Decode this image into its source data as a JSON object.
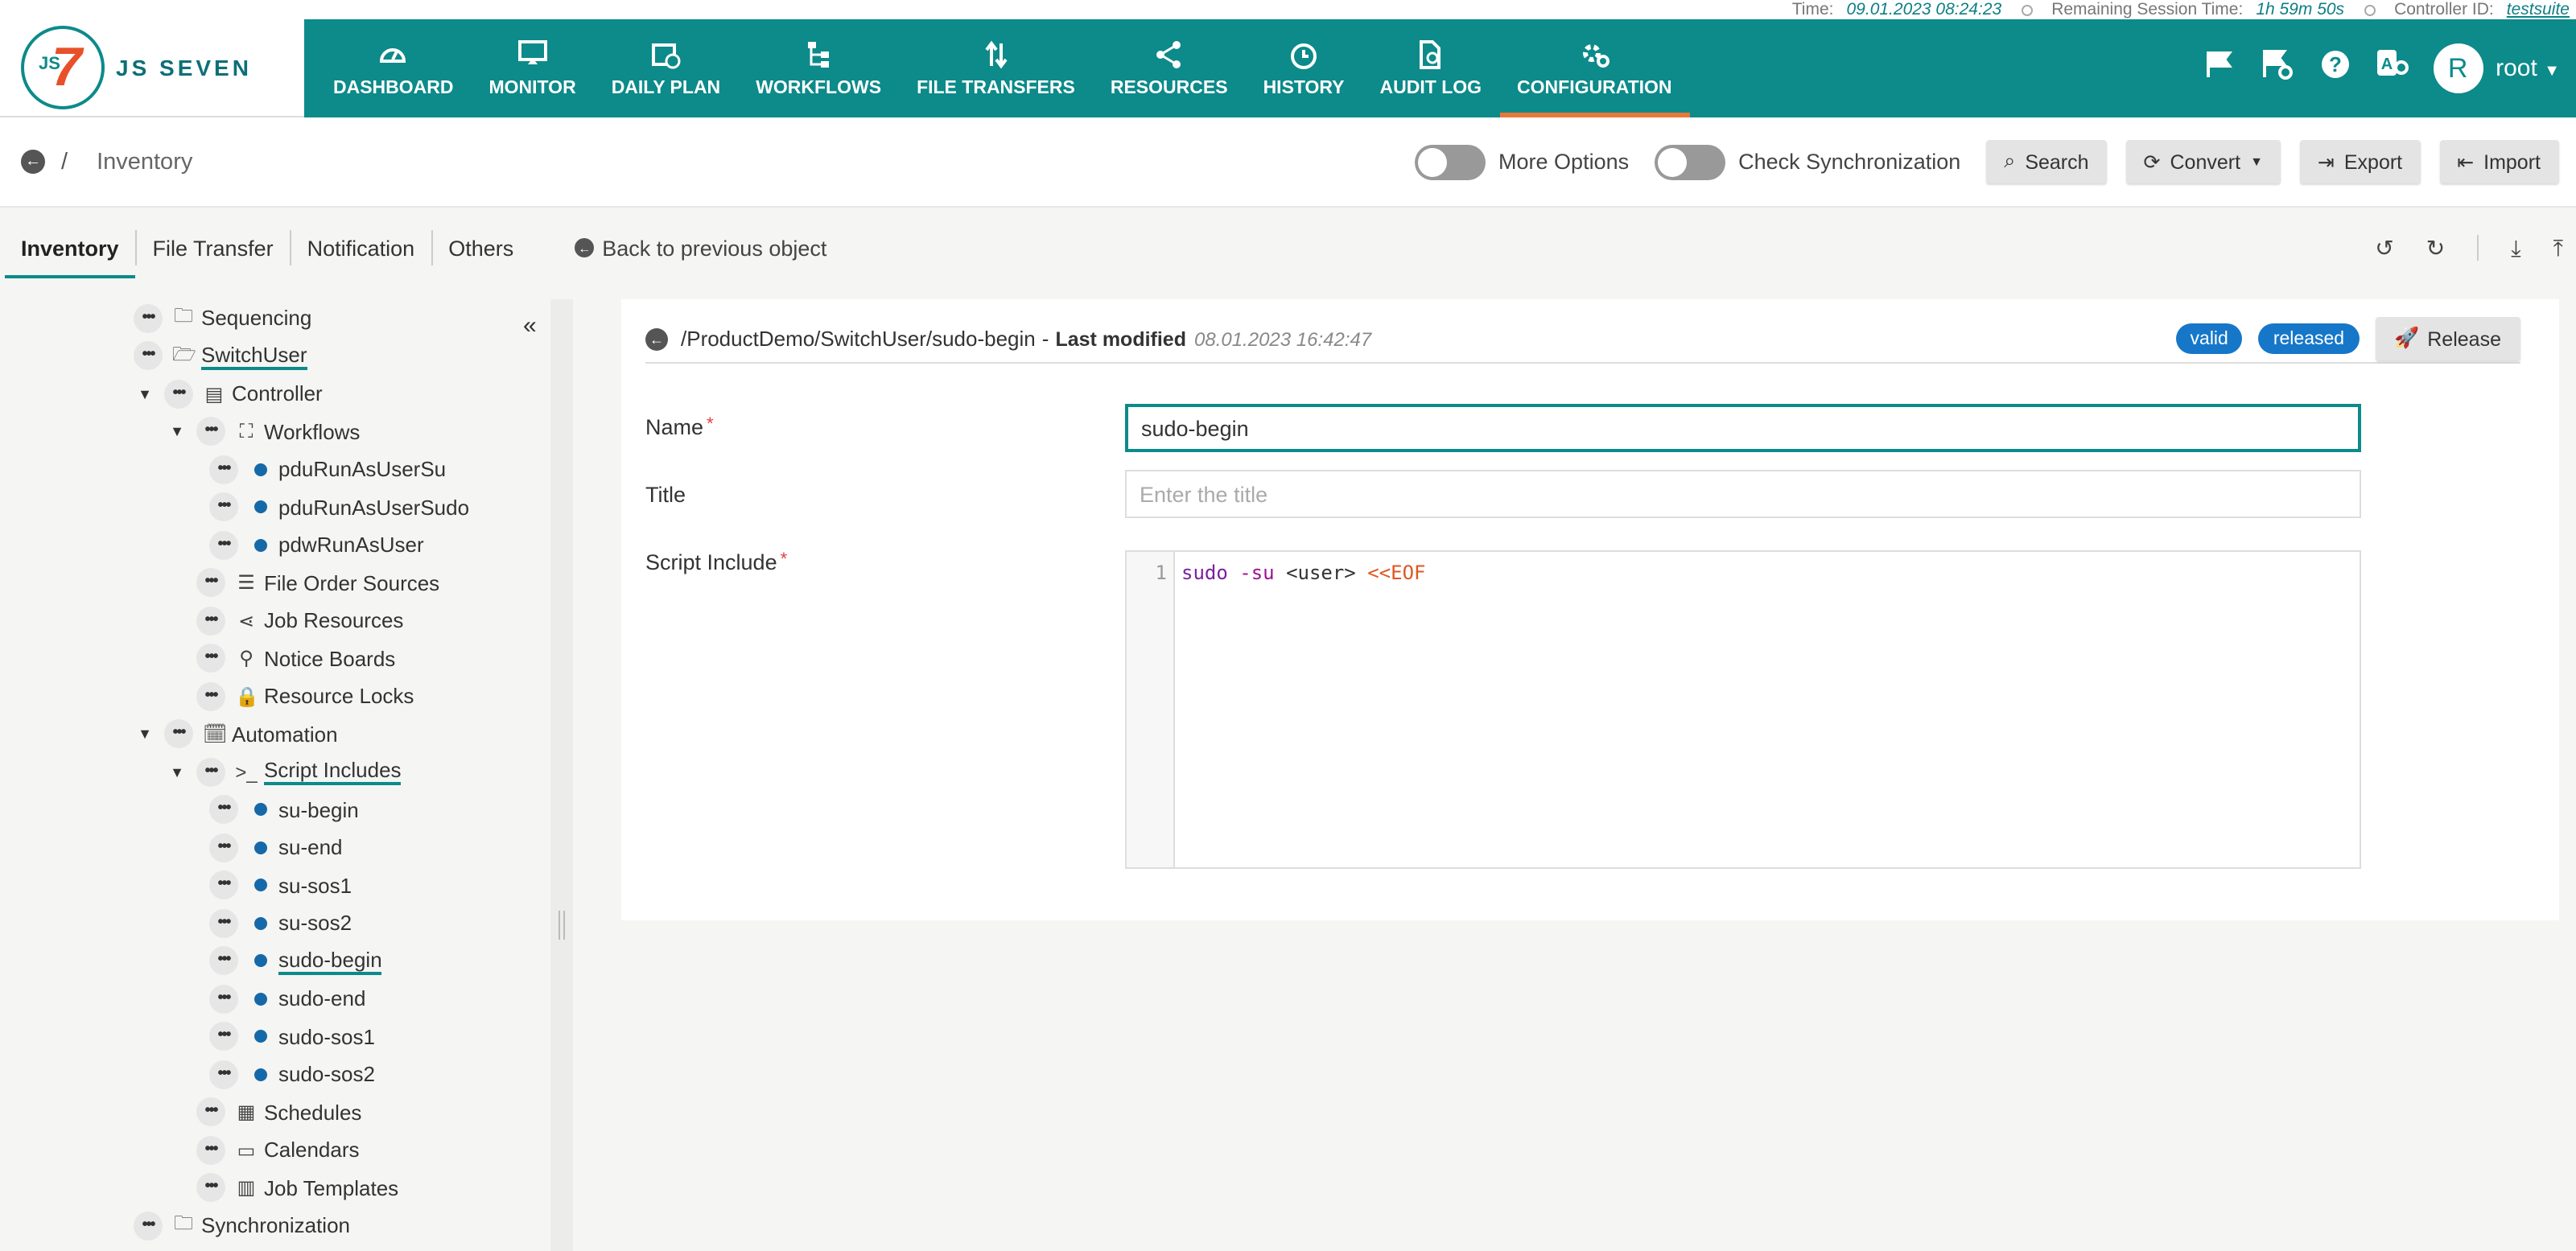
{
  "status": {
    "time_label": "Time:",
    "time_value": "09.01.2023 08:24:23",
    "session_label": "Remaining Session Time:",
    "session_value": "1h 59m 50s",
    "controller_label": "Controller ID:",
    "controller_value": "testsuite"
  },
  "brand": {
    "logo_js": "JS",
    "logo_seven": "7",
    "name": "JS SEVEN"
  },
  "nav": [
    {
      "label": "DASHBOARD",
      "icon": "dashboard-icon"
    },
    {
      "label": "MONITOR",
      "icon": "monitor-icon"
    },
    {
      "label": "DAILY PLAN",
      "icon": "calendar-clock-icon"
    },
    {
      "label": "WORKFLOWS",
      "icon": "workflow-icon"
    },
    {
      "label": "FILE TRANSFERS",
      "icon": "transfer-icon"
    },
    {
      "label": "RESOURCES",
      "icon": "share-icon"
    },
    {
      "label": "HISTORY",
      "icon": "clock-icon"
    },
    {
      "label": "AUDIT LOG",
      "icon": "audit-icon"
    },
    {
      "label": "CONFIGURATION",
      "icon": "gear-icon"
    }
  ],
  "user": {
    "initial": "R",
    "name": "root"
  },
  "subheader": {
    "breadcrumb_sep": "/",
    "page_title": "Inventory",
    "more_options": "More Options",
    "check_sync": "Check Synchronization",
    "search": "Search",
    "convert": "Convert",
    "export": "Export",
    "import": "Import"
  },
  "tabs": [
    "Inventory",
    "File Transfer",
    "Notification",
    "Others"
  ],
  "back_to_previous": "Back to previous object",
  "tree": [
    {
      "label": "Sequencing",
      "indent": 0,
      "kind": "folder"
    },
    {
      "label": "SwitchUser",
      "indent": 0,
      "kind": "folder-open"
    },
    {
      "label": "Controller",
      "indent": 1,
      "kind": "controller"
    },
    {
      "label": "Workflows",
      "indent": 2,
      "kind": "workflows"
    },
    {
      "label": "pduRunAsUserSu",
      "indent": 3,
      "kind": "item"
    },
    {
      "label": "pduRunAsUserSudo",
      "indent": 3,
      "kind": "item"
    },
    {
      "label": "pdwRunAsUser",
      "indent": 3,
      "kind": "item"
    },
    {
      "label": "File Order Sources",
      "indent": 2,
      "kind": "list"
    },
    {
      "label": "Job Resources",
      "indent": 2,
      "kind": "share"
    },
    {
      "label": "Notice Boards",
      "indent": 2,
      "kind": "pin"
    },
    {
      "label": "Resource Locks",
      "indent": 2,
      "kind": "lock"
    },
    {
      "label": "Automation",
      "indent": 1,
      "kind": "automation"
    },
    {
      "label": "Script Includes",
      "indent": 2,
      "kind": "terminal"
    },
    {
      "label": "su-begin",
      "indent": 3,
      "kind": "item"
    },
    {
      "label": "su-end",
      "indent": 3,
      "kind": "item"
    },
    {
      "label": "su-sos1",
      "indent": 3,
      "kind": "item"
    },
    {
      "label": "su-sos2",
      "indent": 3,
      "kind": "item"
    },
    {
      "label": "sudo-begin",
      "indent": 3,
      "kind": "item"
    },
    {
      "label": "sudo-end",
      "indent": 3,
      "kind": "item"
    },
    {
      "label": "sudo-sos1",
      "indent": 3,
      "kind": "item"
    },
    {
      "label": "sudo-sos2",
      "indent": 3,
      "kind": "item"
    },
    {
      "label": "Schedules",
      "indent": 2,
      "kind": "schedule"
    },
    {
      "label": "Calendars",
      "indent": 2,
      "kind": "calendar"
    },
    {
      "label": "Job Templates",
      "indent": 2,
      "kind": "template"
    },
    {
      "label": "Synchronization",
      "indent": 0,
      "kind": "folder"
    }
  ],
  "detail": {
    "path": "/ProductDemo/SwitchUser/sudo-begin",
    "dash": "-",
    "last_modified_label": "Last modified",
    "last_modified_value": "08.01.2023 16:42:47",
    "badge_valid": "valid",
    "badge_released": "released",
    "release": "Release",
    "name_label": "Name",
    "name_value": "sudo-begin",
    "title_label": "Title",
    "title_placeholder": "Enter the title",
    "script_label": "Script Include",
    "required_mark": "*",
    "code_line_no": "1",
    "code_tokens": [
      "sudo",
      " -su ",
      "<user>",
      " <<EOF"
    ]
  },
  "colors": {
    "header": "#0d8a8a",
    "accent": "#e8783a",
    "badge": "#1677c9",
    "bullet": "#1669a8"
  }
}
